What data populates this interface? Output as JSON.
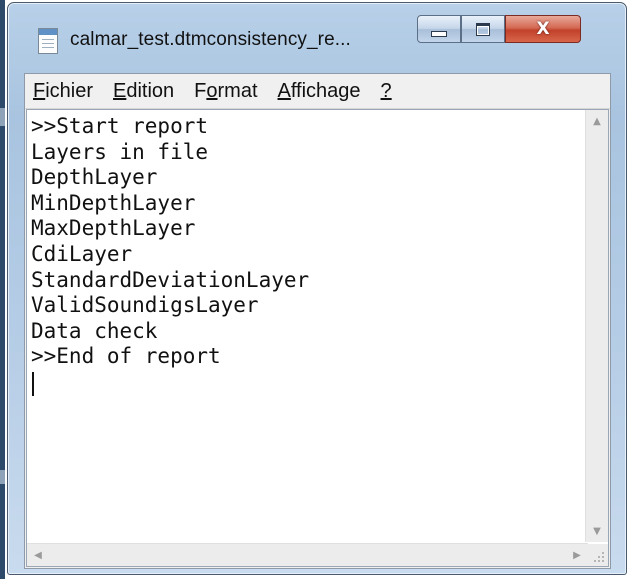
{
  "window": {
    "title": "calmar_test.dtmconsistency_re...",
    "buttons": {
      "minimize": "minimize",
      "maximize": "maximize",
      "close": "X"
    }
  },
  "menu": {
    "items": [
      {
        "pre": "",
        "accel": "F",
        "post": "ichier"
      },
      {
        "pre": "",
        "accel": "E",
        "post": "dition"
      },
      {
        "pre": "F",
        "accel": "o",
        "post": "rmat"
      },
      {
        "pre": "",
        "accel": "A",
        "post": "ffichage"
      },
      {
        "pre": "",
        "accel": "?",
        "post": ""
      }
    ]
  },
  "editor": {
    "lines": [
      ">>Start report",
      "Layers in file",
      "DepthLayer",
      "MinDepthLayer",
      "MaxDepthLayer",
      "CdiLayer",
      "StandardDeviationLayer",
      "ValidSoundigsLayer",
      "Data check",
      ">>End of report"
    ]
  },
  "icons": {
    "app": "notepad-icon",
    "scroll_up": "scroll-up-arrow-icon",
    "scroll_down": "scroll-down-arrow-icon",
    "scroll_left": "scroll-left-arrow-icon",
    "scroll_right": "scroll-right-arrow-icon",
    "grip": "resize-grip-icon"
  },
  "colors": {
    "close_button": "#c9482f",
    "frame": "#b6cde6"
  }
}
